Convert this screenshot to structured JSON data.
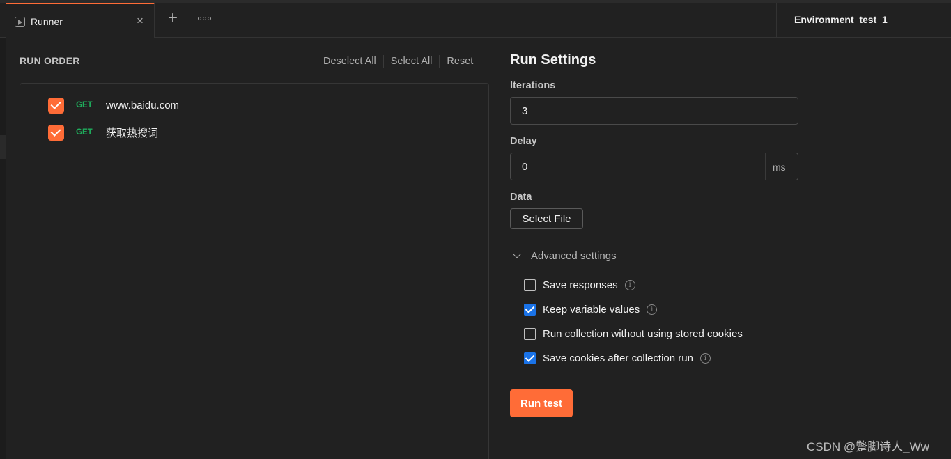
{
  "tab": {
    "label": "Runner",
    "close": "×",
    "add": "+"
  },
  "environment": {
    "label": "Environment_test_1"
  },
  "run_order": {
    "title": "RUN ORDER",
    "actions": [
      "Deselect All",
      "Select All",
      "Reset"
    ],
    "items": [
      {
        "method": "GET",
        "name": "www.baidu.com",
        "checked": true
      },
      {
        "method": "GET",
        "name": "获取热搜词",
        "checked": true
      }
    ]
  },
  "run_settings": {
    "title": "Run Settings",
    "iterations": {
      "label": "Iterations",
      "value": "3"
    },
    "delay": {
      "label": "Delay",
      "value": "0",
      "unit": "ms"
    },
    "data": {
      "label": "Data",
      "button": "Select File"
    },
    "advanced": {
      "label": "Advanced settings",
      "options": [
        {
          "label": "Save responses",
          "checked": false,
          "info": true
        },
        {
          "label": "Keep variable values",
          "checked": true,
          "info": true
        },
        {
          "label": "Run collection without using stored cookies",
          "checked": false,
          "info": false
        },
        {
          "label": "Save cookies after collection run",
          "checked": true,
          "info": true
        }
      ]
    },
    "run_button": "Run test"
  },
  "watermark": "CSDN @蹩脚诗人_Ww",
  "colors": {
    "accent": "#ff6c37",
    "method_get": "#1fad5c",
    "checkbox_blue": "#1a73e8"
  }
}
